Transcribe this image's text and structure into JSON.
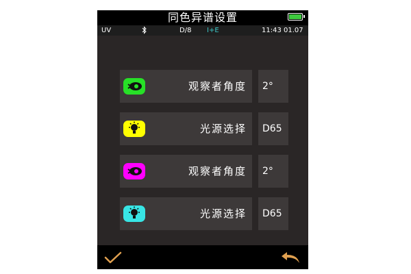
{
  "header": {
    "title": "同色异谱设置"
  },
  "status": {
    "mode": "UV",
    "geometry": "D/8",
    "specular": "I+E",
    "specular_color": "#3cc7c7",
    "time": "11:43 01.07"
  },
  "rows": [
    {
      "label": "观察者角度",
      "value": "2°",
      "icon": "eye-icon",
      "color": "#27e027"
    },
    {
      "label": "光源选择",
      "value": "D65",
      "icon": "bulb-icon",
      "color": "#ffff00"
    },
    {
      "label": "观察者角度",
      "value": "2°",
      "icon": "eye-icon",
      "color": "#ff00ff"
    },
    {
      "label": "光源选择",
      "value": "D65",
      "icon": "bulb-icon",
      "color": "#38e5e5"
    }
  ],
  "footer": {
    "confirm_icon": "checkmark-icon",
    "back_icon": "back-arrow-icon"
  }
}
